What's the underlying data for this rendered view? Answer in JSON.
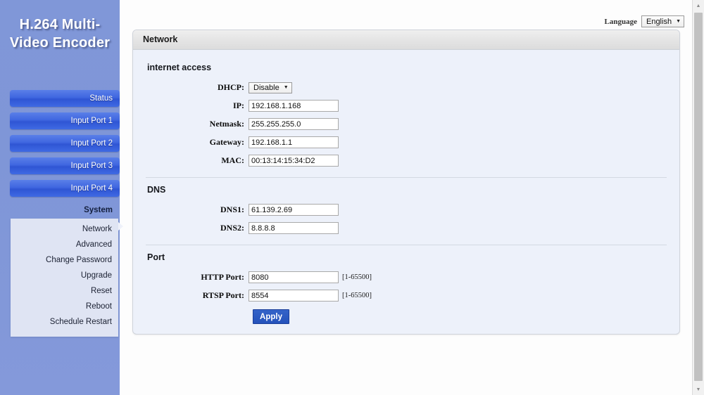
{
  "brand": {
    "line1": "H.264 Multi-",
    "line2": "Video Encoder"
  },
  "topbar": {
    "language_label": "Language",
    "language_value": "English",
    "language_arrow": "▼"
  },
  "sidebar": {
    "buttons": [
      {
        "label": "Status"
      },
      {
        "label": "Input Port 1"
      },
      {
        "label": "Input Port 2"
      },
      {
        "label": "Input Port 3"
      },
      {
        "label": "Input Port 4"
      }
    ],
    "active_group": "System",
    "submenu": [
      {
        "label": "Network"
      },
      {
        "label": "Advanced"
      },
      {
        "label": "Change Password"
      },
      {
        "label": "Upgrade"
      },
      {
        "label": "Reset"
      },
      {
        "label": "Reboot"
      },
      {
        "label": "Schedule Restart"
      }
    ]
  },
  "panel": {
    "title": "Network",
    "sections": {
      "internet": {
        "title": "internet access",
        "dhcp_label": "DHCP:",
        "dhcp_value": "Disable",
        "dhcp_arrow": "▼",
        "ip_label": "IP:",
        "ip_value": "192.168.1.168",
        "netmask_label": "Netmask:",
        "netmask_value": "255.255.255.0",
        "gateway_label": "Gateway:",
        "gateway_value": "192.168.1.1",
        "mac_label": "MAC:",
        "mac_value": "00:13:14:15:34:D2"
      },
      "dns": {
        "title": "DNS",
        "dns1_label": "DNS1:",
        "dns1_value": "61.139.2.69",
        "dns2_label": "DNS2:",
        "dns2_value": "8.8.8.8"
      },
      "port": {
        "title": "Port",
        "http_label": "HTTP Port:",
        "http_value": "8080",
        "http_hint": "[1-65500]",
        "rtsp_label": "RTSP Port:",
        "rtsp_value": "8554",
        "rtsp_hint": "[1-65500]",
        "apply_label": "Apply"
      }
    }
  },
  "scrollbar": {
    "up_arrow": "▲",
    "down_arrow": "▼"
  },
  "colors": {
    "sidebar_blue": "#8097d8",
    "nav_button_blue": "#3f66e0",
    "panel_body": "#edf1fa",
    "apply_blue": "#2452bb",
    "submenu_bg": "#dfe4f3"
  }
}
